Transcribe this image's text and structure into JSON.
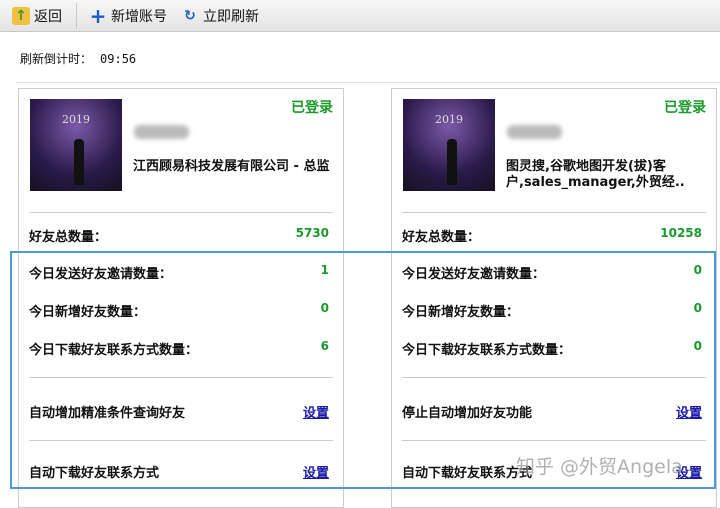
{
  "toolbar": {
    "back": "返回",
    "add_account": "新增账号",
    "refresh_now": "立即刷新"
  },
  "countdown": {
    "label": "刷新倒计时：",
    "value": "09:56"
  },
  "cards": [
    {
      "status": "已登录",
      "photo_text": "2019",
      "company": "江西顾易科技发展有限公司 - 总监",
      "total_friends_label": "好友总数量：",
      "total_friends": "5730",
      "invites_label": "今日发送好友邀请数量：",
      "invites": "1",
      "new_friends_label": "今日新增好友数量：",
      "new_friends": "0",
      "downloads_label": "今日下载好友联系方式数量：",
      "downloads": "6",
      "action1_label": "自动增加精准条件查询好友",
      "action1_link": "设置",
      "action2_label": "自动下载好友联系方式",
      "action2_link": "设置"
    },
    {
      "status": "已登录",
      "photo_text": "2019",
      "company": "图灵搜,谷歌地图开发(拔)客户,sales_manager,外贸经..",
      "total_friends_label": "好友总数量：",
      "total_friends": "10258",
      "invites_label": "今日发送好友邀请数量：",
      "invites": "0",
      "new_friends_label": "今日新增好友数量：",
      "new_friends": "0",
      "downloads_label": "今日下载好友联系方式数量：",
      "downloads": "0",
      "action1_label": "停止自动增加好友功能",
      "action1_link": "设置",
      "action2_label": "自动下载好友联系方式",
      "action2_link": "设置"
    }
  ],
  "watermark": "知乎 @外贸Angela",
  "colors": {
    "status": "#1a9a2a",
    "highlight": "#4a9ad8",
    "link": "#1a1aa8"
  }
}
